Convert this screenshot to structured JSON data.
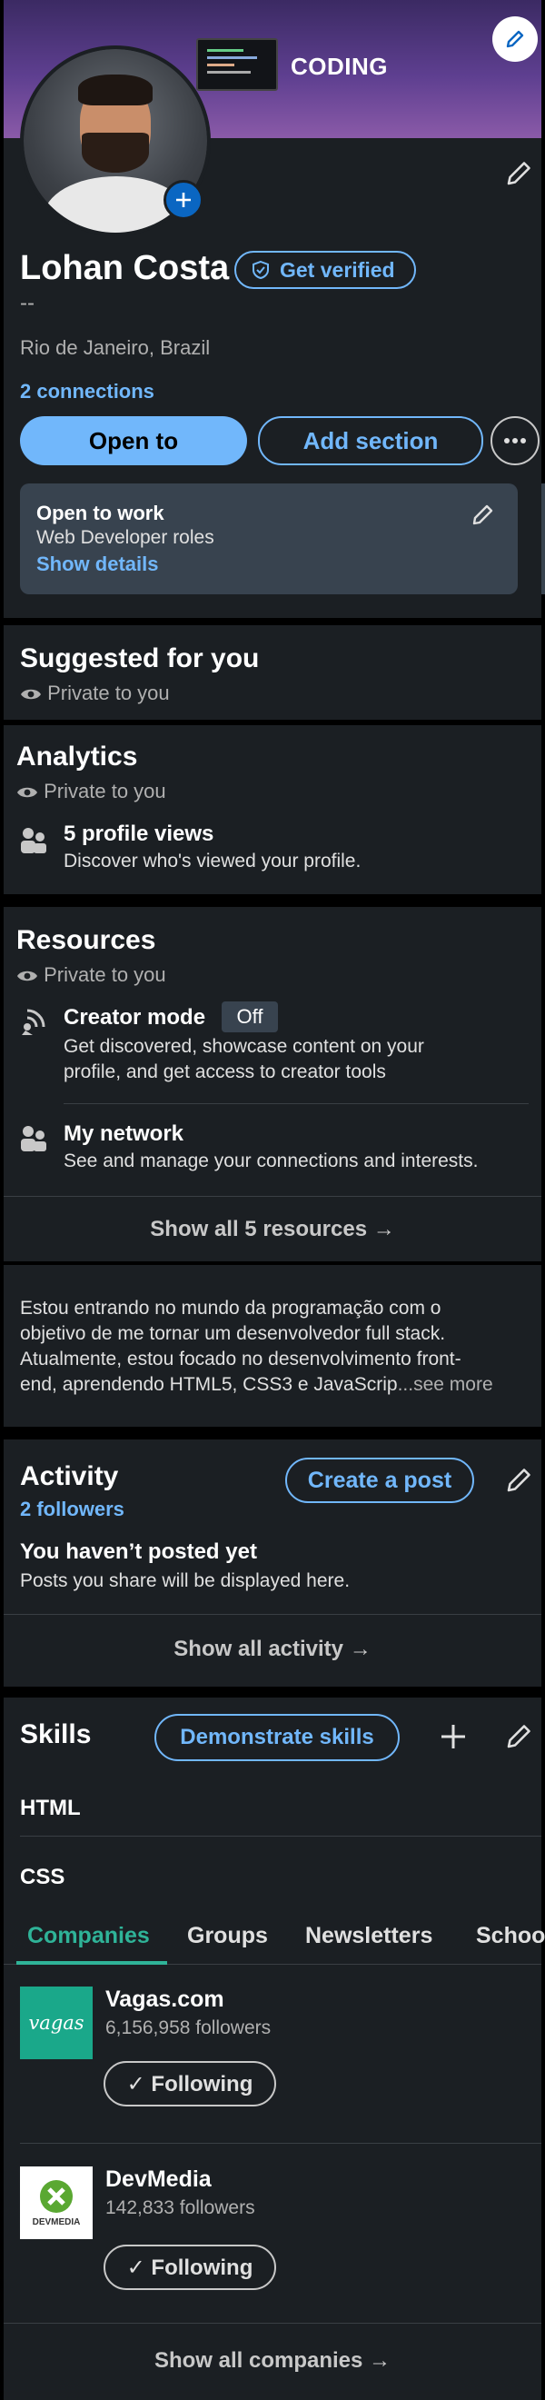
{
  "banner": {
    "text": "CODING",
    "edit_icon": "pencil-icon"
  },
  "profile": {
    "name": "Lohan Costa",
    "verify_label": "Get verified",
    "headline": "--",
    "location": "Rio de Janeiro, Brazil",
    "connections": "2 connections",
    "open_to_label": "Open to",
    "add_section_label": "Add section",
    "open_to_work": {
      "title": "Open to work",
      "roles": "Web Developer roles",
      "details_link": "Show details"
    }
  },
  "suggested": {
    "title": "Suggested for you",
    "privacy": "Private to you"
  },
  "analytics": {
    "title": "Analytics",
    "privacy": "Private to you",
    "views_title": "5 profile views",
    "views_desc": "Discover who's viewed your profile."
  },
  "resources": {
    "title": "Resources",
    "privacy": "Private to you",
    "creator_title": "Creator mode",
    "creator_badge": "Off",
    "creator_desc_1": "Get discovered, showcase content on your",
    "creator_desc_2": "profile, and get access to creator tools",
    "network_title": "My network",
    "network_desc": "See and manage your connections and interests.",
    "show_all": "Show all 5 resources →"
  },
  "about": {
    "line1": "Estou entrando no mundo da programação com o",
    "line2": "objetivo de me tornar um desenvolvedor full stack.",
    "line3": "Atualmente, estou focado no desenvolvimento front-",
    "line4": "end, aprendendo HTML5, CSS3 e JavaScrip",
    "see_more": "...see more"
  },
  "activity": {
    "title": "Activity",
    "followers": "2 followers",
    "create_post": "Create a post",
    "empty_title": "You haven’t posted yet",
    "empty_desc": "Posts you share will be displayed here.",
    "show_all": "Show all activity →"
  },
  "skills": {
    "title": "Skills",
    "demonstrate": "Demonstrate skills",
    "items": [
      "HTML",
      "CSS"
    ]
  },
  "interests": {
    "tabs": [
      "Companies",
      "Groups",
      "Newsletters",
      "Schoo"
    ],
    "companies": [
      {
        "name": "Vagas.com",
        "followers": "6,156,958 followers",
        "logo": "vagas",
        "button": "✓ Following"
      },
      {
        "name": "DevMedia",
        "followers": "142,833 followers",
        "logo": "DEVMEDIA",
        "button": "✓ Following"
      }
    ],
    "show_all": "Show all companies →"
  },
  "colors": {
    "accent": "#71b7fb",
    "card": "#1b1f23",
    "banner": "#5a3f86",
    "vagas": "#1aa88a"
  }
}
